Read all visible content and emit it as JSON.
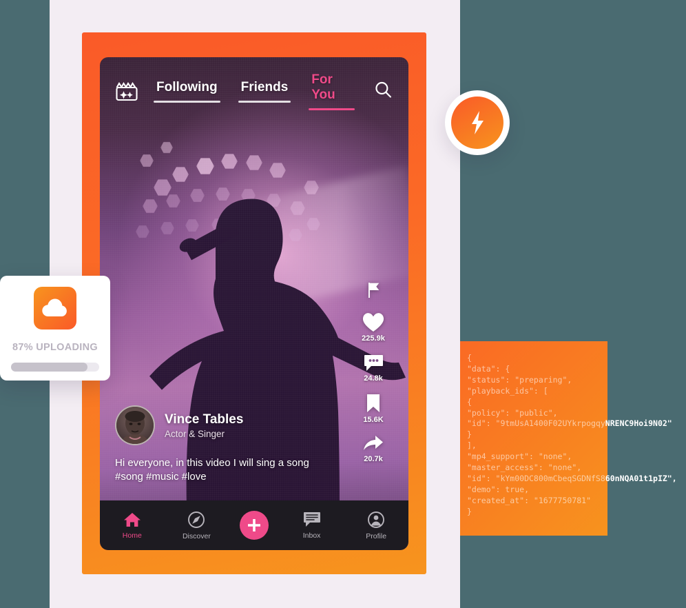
{
  "background": {
    "slate_color": "#4a6b71",
    "panel_color": "#f3edf3"
  },
  "phone": {
    "frame_gradient_from": "#fa5a28",
    "frame_gradient_to": "#f7941e",
    "top_nav": {
      "film_icon": "film-clapper-icon",
      "search_icon": "search-icon",
      "tabs": [
        {
          "label": "Following",
          "active": false
        },
        {
          "label": "Friends",
          "active": false
        },
        {
          "label": "For You",
          "active": true
        }
      ],
      "active_color": "#ef4a89"
    },
    "actions": [
      {
        "icon": "flag-icon",
        "count": ""
      },
      {
        "icon": "heart-icon",
        "count": "225.9k"
      },
      {
        "icon": "comment-icon",
        "count": "24.8k"
      },
      {
        "icon": "bookmark-icon",
        "count": "15.6K"
      },
      {
        "icon": "share-icon",
        "count": "20.7k"
      }
    ],
    "post": {
      "author_name": "Vince Tables",
      "author_role": "Actor & Singer",
      "caption_line1": "Hi everyone, in this video I will sing a song",
      "caption_line2": "#song  #music #love"
    },
    "bottom_nav": {
      "items": [
        {
          "label": "Home",
          "icon": "home-icon",
          "active": true
        },
        {
          "label": "Discover",
          "icon": "compass-icon",
          "active": false
        },
        {
          "label": "Inbox",
          "icon": "inbox-icon",
          "active": false
        },
        {
          "label": "Profile",
          "icon": "profile-icon",
          "active": false
        }
      ],
      "create_icon": "plus-icon",
      "create_color": "#ef4a89"
    }
  },
  "upload_card": {
    "icon": "cloud-upload-icon",
    "status_text": "87% UPLOADING",
    "progress_percent": 87,
    "icon_gradient_from": "#f7941e",
    "icon_gradient_to": "#fa5a28"
  },
  "bolt_badge": {
    "icon": "lightning-bolt-icon",
    "gradient_from": "#fa5a28",
    "gradient_to": "#f7941e"
  },
  "code_panel": {
    "background_from": "#fa6a24",
    "background_to": "#f7931e",
    "lines": [
      "{",
      "\"data\": {",
      "\"status\": \"preparing\",",
      "\"playback_ids\": [",
      "{",
      "\"policy\": \"public\",",
      "\"id\": \"9tmUsA1400F02UYkrpogqyNRENC9Hoi9N02\"",
      "}",
      "],",
      "\"mp4_support\": \"none\",",
      "\"master_access\": \"none\",",
      "\"id\": \"kYm00DC800mCbeqSGDNfS860nNQA01t1pIZ\",",
      "\"demo\": true,",
      "\"created_at\": \"1677750781\"",
      "}"
    ]
  }
}
